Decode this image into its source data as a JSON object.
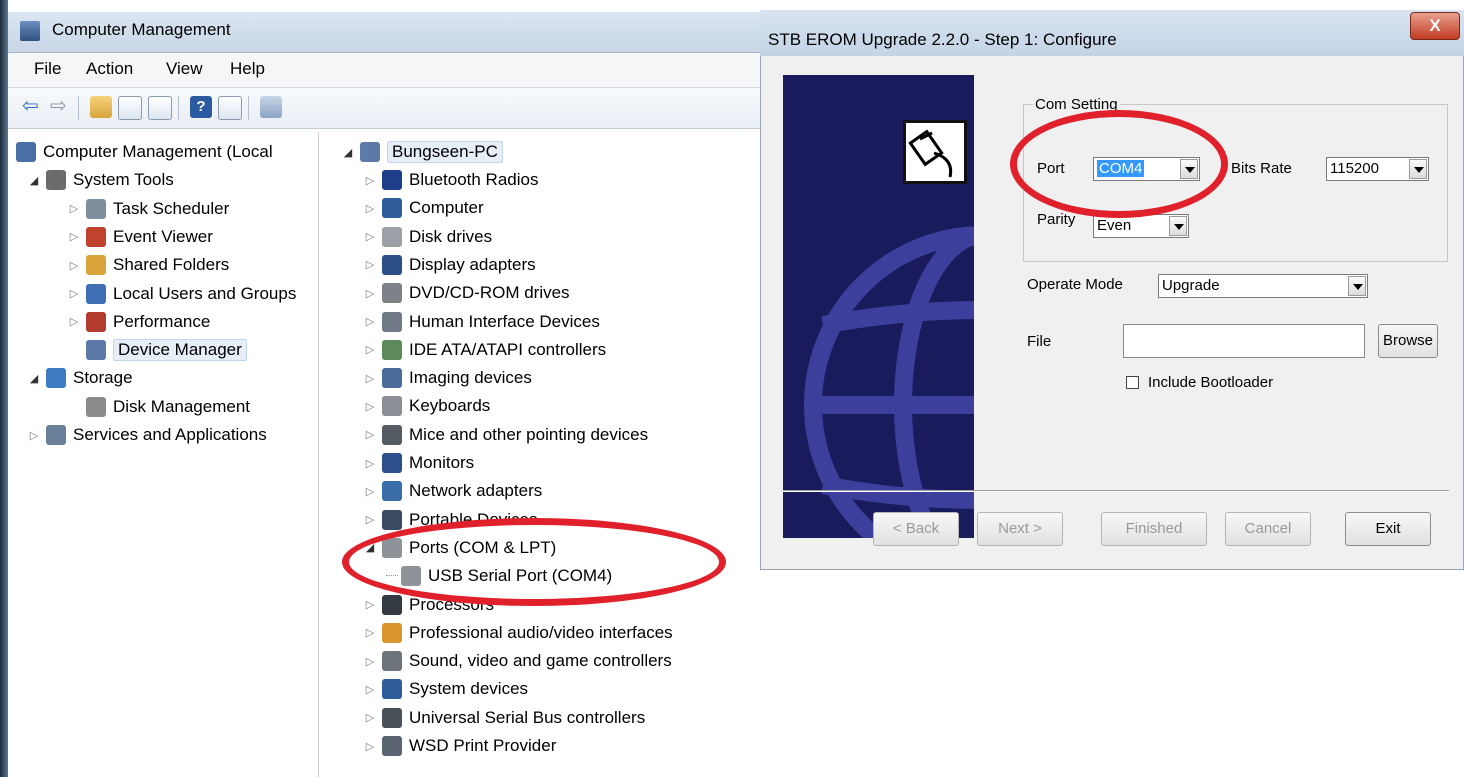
{
  "computer_management": {
    "title": "Computer Management",
    "menu": [
      "File",
      "Action",
      "View",
      "Help"
    ],
    "left_tree": [
      {
        "label": "Computer Management (Local",
        "level": 0,
        "arrow": "",
        "icon": "computer-management-icon",
        "color": "#4a6fa5"
      },
      {
        "label": "System Tools",
        "level": 1,
        "arrow": "open",
        "icon": "system-tools-icon",
        "color": "#6b6b6b"
      },
      {
        "label": "Task Scheduler",
        "level": 2,
        "arrow": "closed",
        "icon": "clock-icon",
        "color": "#7d8e9c"
      },
      {
        "label": "Event Viewer",
        "level": 2,
        "arrow": "closed",
        "icon": "event-viewer-icon",
        "color": "#c0432e"
      },
      {
        "label": "Shared Folders",
        "level": 2,
        "arrow": "closed",
        "icon": "shared-folder-icon",
        "color": "#d9a43a"
      },
      {
        "label": "Local Users and Groups",
        "level": 2,
        "arrow": "closed",
        "icon": "users-icon",
        "color": "#3e6eb3"
      },
      {
        "label": "Performance",
        "level": 2,
        "arrow": "closed",
        "icon": "performance-icon",
        "color": "#b33a2f"
      },
      {
        "label": "Device Manager",
        "level": 2,
        "arrow": "",
        "icon": "device-manager-icon",
        "color": "#5b7aa8",
        "selected": true
      },
      {
        "label": "Storage",
        "level": 1,
        "arrow": "open",
        "icon": "storage-icon",
        "color": "#3f7cc4"
      },
      {
        "label": "Disk Management",
        "level": 2,
        "arrow": "",
        "icon": "disk-icon",
        "color": "#8a8a8a"
      },
      {
        "label": "Services and Applications",
        "level": 1,
        "arrow": "closed",
        "icon": "services-icon",
        "color": "#6a7f99"
      }
    ],
    "device_tree": {
      "root": "Bungseen-PC",
      "items": [
        {
          "label": "Bluetooth Radios",
          "icon": "bluetooth-icon",
          "color": "#1f3f8a",
          "arrow": "closed"
        },
        {
          "label": "Computer",
          "icon": "computer-icon",
          "color": "#2f5d9a",
          "arrow": "closed"
        },
        {
          "label": "Disk drives",
          "icon": "disk-drive-icon",
          "color": "#9aa0a6",
          "arrow": "closed"
        },
        {
          "label": "Display adapters",
          "icon": "display-adapter-icon",
          "color": "#2b4f86",
          "arrow": "closed"
        },
        {
          "label": "DVD/CD-ROM drives",
          "icon": "dvd-drive-icon",
          "color": "#7c8288",
          "arrow": "closed"
        },
        {
          "label": "Human Interface Devices",
          "icon": "hid-icon",
          "color": "#6f7a86",
          "arrow": "closed"
        },
        {
          "label": "IDE ATA/ATAPI controllers",
          "icon": "ide-controller-icon",
          "color": "#5d8a5a",
          "arrow": "closed"
        },
        {
          "label": "Imaging devices",
          "icon": "imaging-icon",
          "color": "#4a6c9a",
          "arrow": "closed"
        },
        {
          "label": "Keyboards",
          "icon": "keyboard-icon",
          "color": "#8c9096",
          "arrow": "closed"
        },
        {
          "label": "Mice and other pointing devices",
          "icon": "mouse-icon",
          "color": "#555b63",
          "arrow": "closed"
        },
        {
          "label": "Monitors",
          "icon": "monitor-icon",
          "color": "#2d4f8a",
          "arrow": "closed"
        },
        {
          "label": "Network adapters",
          "icon": "network-adapter-icon",
          "color": "#3a6ea8",
          "arrow": "closed"
        },
        {
          "label": "Portable Devices",
          "icon": "portable-device-icon",
          "color": "#3b4a5e",
          "arrow": "closed"
        },
        {
          "label": "Ports (COM & LPT)",
          "icon": "port-icon",
          "color": "#8d9399",
          "arrow": "open"
        },
        {
          "label": "USB Serial Port (COM4)",
          "icon": "port-icon",
          "color": "#8d9399",
          "arrow": "child"
        },
        {
          "label": "Processors",
          "icon": "processor-icon",
          "color": "#333a42",
          "arrow": "closed"
        },
        {
          "label": "Professional audio/video interfaces",
          "icon": "audio-video-icon",
          "color": "#d9952e",
          "arrow": "closed"
        },
        {
          "label": "Sound, video and game controllers",
          "icon": "speaker-icon",
          "color": "#6d747c",
          "arrow": "closed"
        },
        {
          "label": "System devices",
          "icon": "system-device-icon",
          "color": "#2f5d9a",
          "arrow": "closed"
        },
        {
          "label": "Universal Serial Bus controllers",
          "icon": "usb-icon",
          "color": "#4b5158",
          "arrow": "closed"
        },
        {
          "label": "WSD Print Provider",
          "icon": "printer-icon",
          "color": "#5a6470",
          "arrow": "closed"
        }
      ]
    }
  },
  "erom_dialog": {
    "title": "STB EROM Upgrade 2.2.0  - Step 1: Configure",
    "close_label": "X",
    "com_setting_legend": "Com Setting",
    "port_label": "Port",
    "port_value": "COM4",
    "bits_rate_label": "Bits Rate",
    "bits_rate_value": "115200",
    "parity_label": "Parity",
    "parity_value": "Even",
    "operate_mode_label": "Operate Mode",
    "operate_mode_value": "Upgrade",
    "file_label": "File",
    "file_value": "",
    "browse_label": "Browse",
    "include_bootloader_label": "Include Bootloader",
    "include_bootloader_checked": false,
    "buttons": {
      "back": "< Back",
      "next": "Next >",
      "finished": "Finished",
      "cancel": "Cancel",
      "exit": "Exit"
    }
  },
  "colors": {
    "highlight_circle": "#e0202a",
    "banner_bg": "#1a1b5c",
    "selected_combo": "#3399ff"
  }
}
